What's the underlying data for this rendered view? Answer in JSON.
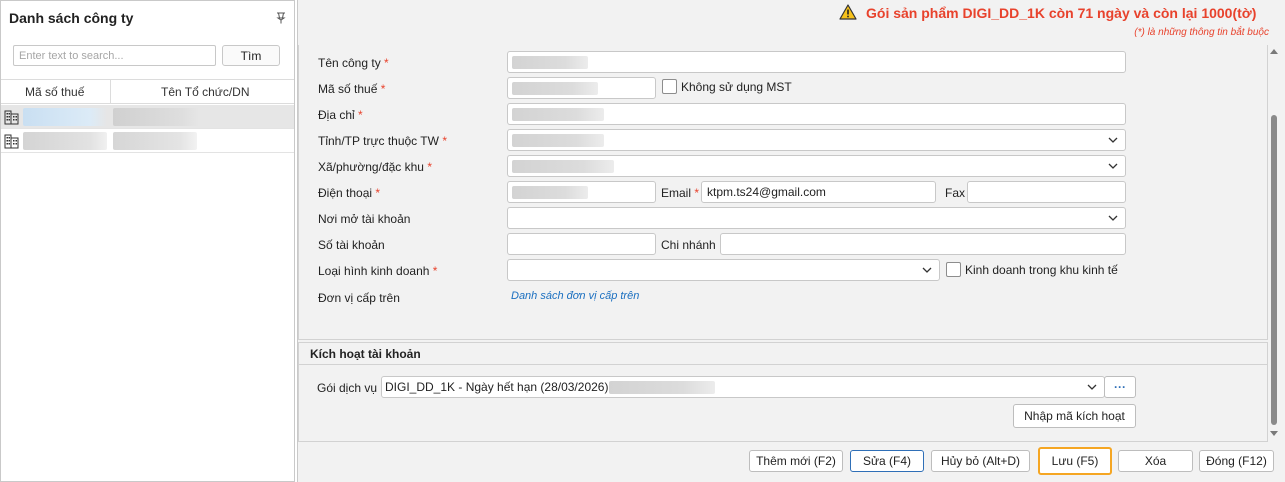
{
  "left": {
    "title": "Danh sách công ty",
    "search_placeholder": "Enter text to search...",
    "search_button": "Tìm",
    "col_tax": "Mã số thuế",
    "col_name": "Tên Tổ chức/DN"
  },
  "header": {
    "notice": "Gói sản phẩm DIGI_DD_1K còn 71 ngày và còn lại 1000(tờ)",
    "required_note": "(*)  là những thông tin bắt buộc"
  },
  "form": {
    "company_name_label": "Tên công ty",
    "tax_code_label": "Mã số thuế",
    "no_tax_label": "Không sử dụng MST",
    "address_label": "Địa chỉ",
    "province_label": "Tỉnh/TP trực thuộc TW",
    "ward_label": "Xã/phường/đặc khu",
    "phone_label": "Điện thoại",
    "email_label": "Email",
    "email_value": "ktpm.ts24@gmail.com",
    "fax_label": "Fax",
    "bank_place_label": "Nơi mở tài khoản",
    "account_no_label": "Số tài khoản",
    "branch_label": "Chi nhánh",
    "business_type_label": "Loại hình kinh doanh",
    "econ_zone_label": "Kinh doanh trong khu kinh tế",
    "parent_unit_label": "Đơn vị cấp trên",
    "parent_unit_link": "Danh sách đơn vị cấp trên",
    "required_mark": "*"
  },
  "activation": {
    "title": "Kích hoạt tài khoản",
    "service_label": "Gói dịch vụ",
    "service_value": "DIGI_DD_1K - Ngày hết hạn (28/03/2026) -",
    "more_button": "···",
    "enter_code_button": "Nhập mã kích hoạt"
  },
  "footer": {
    "add_new": "Thêm mới (F2)",
    "edit": "Sửa (F4)",
    "cancel": "Hủy bỏ (Alt+D)",
    "save": "Lưu (F5)",
    "delete": "Xóa",
    "close": "Đóng (F12)"
  },
  "colors": {
    "accent_red": "#e8422c",
    "link_blue": "#1a6fc0",
    "save_highlight": "#f5a623"
  }
}
